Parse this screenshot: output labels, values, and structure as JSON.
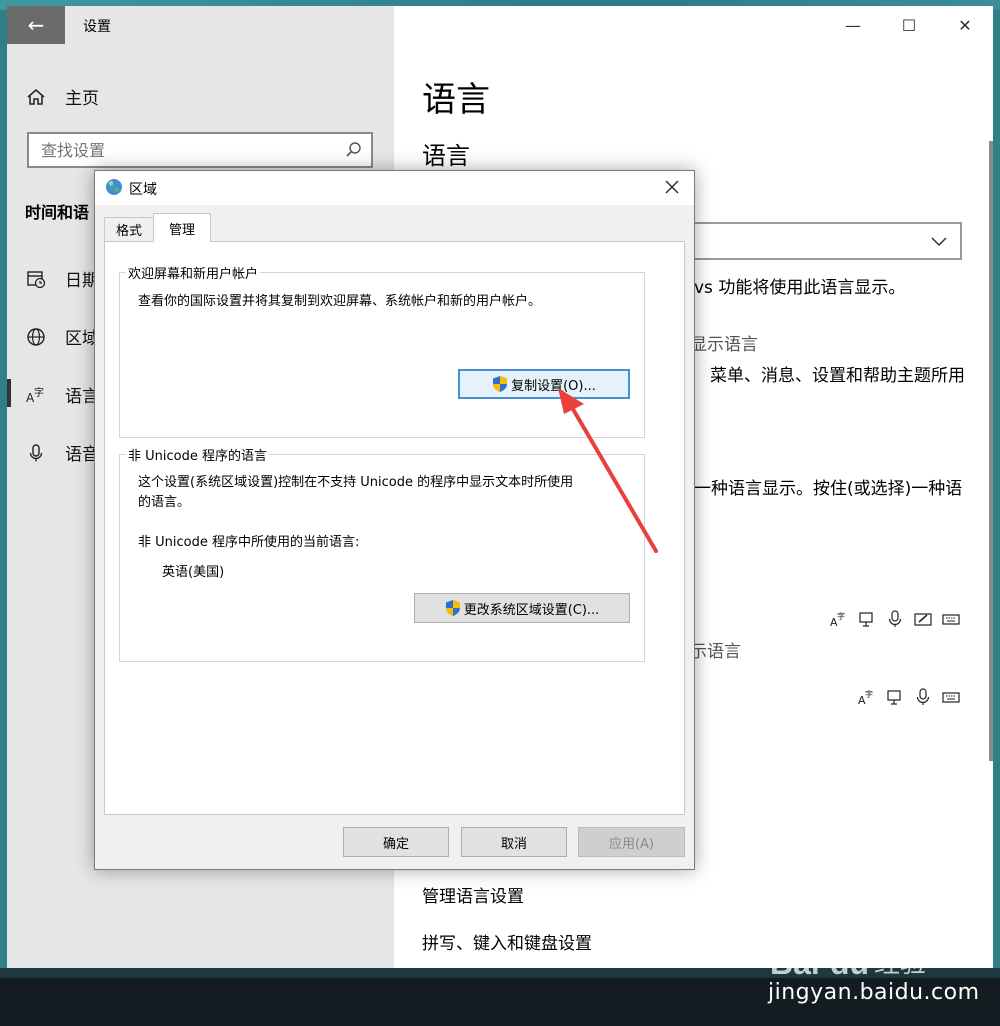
{
  "window": {
    "title": "设置",
    "back": "←",
    "minimize": "—",
    "maximize": "☐",
    "close": "✕"
  },
  "sidebar": {
    "home": "主页",
    "search_placeholder": "查找设置",
    "section": "时间和语",
    "items": [
      {
        "label": "日期",
        "icon": "calendar-clock-icon"
      },
      {
        "label": "区域",
        "icon": "globe-icon"
      },
      {
        "label": "语言",
        "icon": "language-icon"
      },
      {
        "label": "语音",
        "icon": "microphone-icon"
      }
    ]
  },
  "content": {
    "title": "语言",
    "subtitle": "语言",
    "line_display": "vs 功能将使用此语言显示。",
    "line_display_lang": "显示语言",
    "line_menus": "菜单、消息、设置和帮助主题所用",
    "line_order": "一种语言显示。按住(或选择)一种语",
    "line_display_lang2": "示语言",
    "manage_lang": "管理语言设置",
    "spelling": "拼写、键入和键盘设置"
  },
  "dialog": {
    "title": "区域",
    "tabs": [
      "格式",
      "管理"
    ],
    "active_tab": "管理",
    "welcome_group": {
      "label": "欢迎屏幕和新用户帐户",
      "desc": "查看你的国际设置并将其复制到欢迎屏幕、系统帐户和新的用户帐户。",
      "button": "复制设置(O)..."
    },
    "unicode_group": {
      "label": "非 Unicode 程序的语言",
      "desc_line1": "这个设置(系统区域设置)控制在不支持 Unicode 的程序中显示文本时所使用",
      "desc_line2": "的语言。",
      "current_label": "非 Unicode 程序中所使用的当前语言:",
      "current_value": "英语(美国)",
      "button": "更改系统区域设置(C)..."
    },
    "buttons": {
      "ok": "确定",
      "cancel": "取消",
      "apply": "应用(A)"
    }
  },
  "watermark": {
    "logo": "Baidu经验",
    "url": "jingyan.baidu.com"
  },
  "colors": {
    "arrow": "#e8403a",
    "primary_border": "#4a90d9"
  }
}
